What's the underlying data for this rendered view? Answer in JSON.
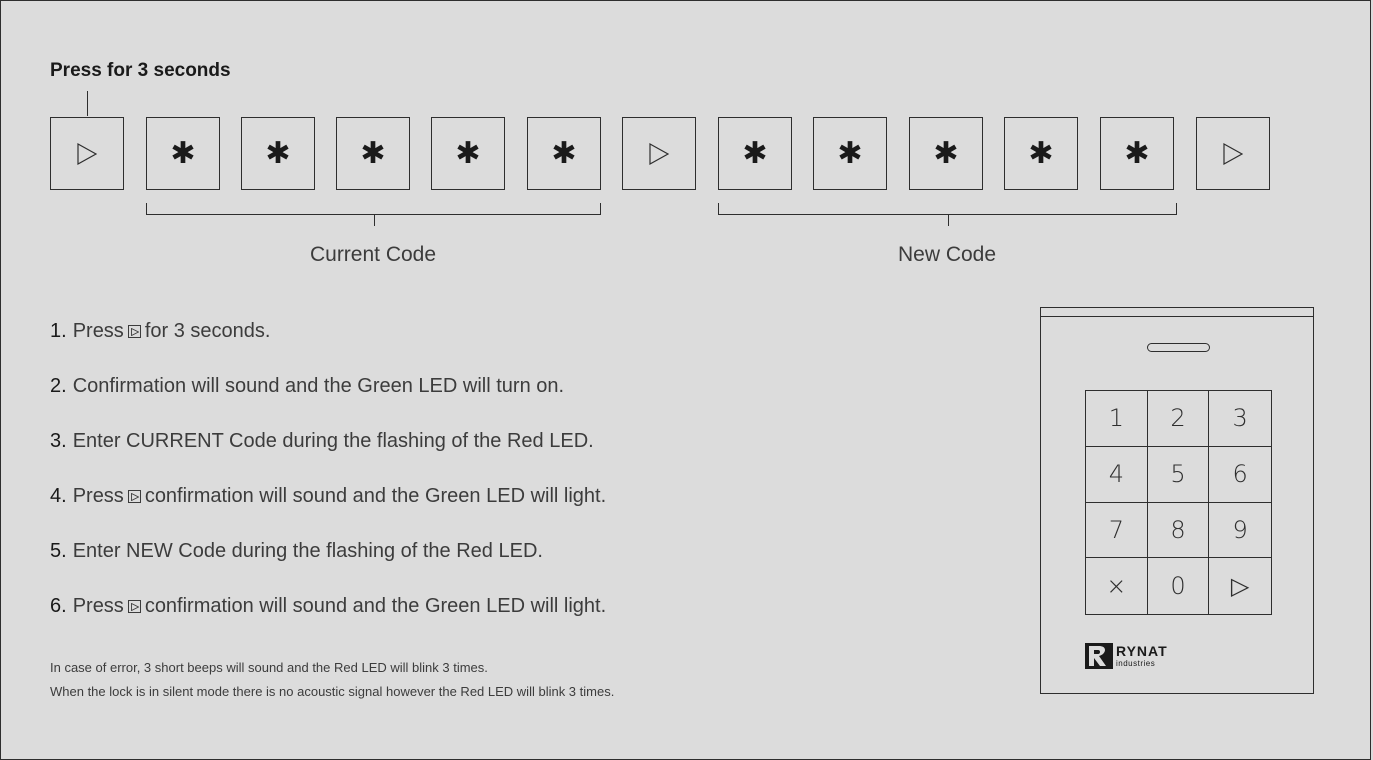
{
  "heading": "Press for 3 seconds",
  "sequence": [
    {
      "icon": "play-icon"
    },
    {
      "icon": "asterisk-icon"
    },
    {
      "icon": "asterisk-icon"
    },
    {
      "icon": "asterisk-icon"
    },
    {
      "icon": "asterisk-icon"
    },
    {
      "icon": "asterisk-icon"
    },
    {
      "icon": "play-icon"
    },
    {
      "icon": "asterisk-icon"
    },
    {
      "icon": "asterisk-icon"
    },
    {
      "icon": "asterisk-icon"
    },
    {
      "icon": "asterisk-icon"
    },
    {
      "icon": "asterisk-icon"
    },
    {
      "icon": "play-icon"
    }
  ],
  "brackets": {
    "current_label": "Current Code",
    "new_label": "New Code"
  },
  "steps": [
    {
      "num": "1.",
      "before": "Press",
      "after": "for 3 seconds."
    },
    {
      "num": "2.",
      "text": "Confirmation will sound and the Green LED will turn on."
    },
    {
      "num": "3.",
      "text": "Enter CURRENT Code during the flashing of the Red LED."
    },
    {
      "num": "4.",
      "before": "Press",
      "after": "confirmation will sound and the Green LED will light."
    },
    {
      "num": "5.",
      "text": "Enter NEW Code during the flashing of the Red LED."
    },
    {
      "num": "6.",
      "before": "Press",
      "after": "confirmation will sound and the Green LED will light."
    }
  ],
  "notes": [
    "In case of error, 3 short beeps will sound and the Red LED will blink 3 times.",
    "When the lock is in silent mode there is no acoustic signal however the Red LED will blink 3 times."
  ],
  "keypad": {
    "keys": [
      "1",
      "2",
      "3",
      "4",
      "5",
      "6",
      "7",
      "8",
      "9",
      "×",
      "0",
      "▷"
    ]
  },
  "brand": {
    "name": "RYNAT",
    "sub": "industries"
  }
}
